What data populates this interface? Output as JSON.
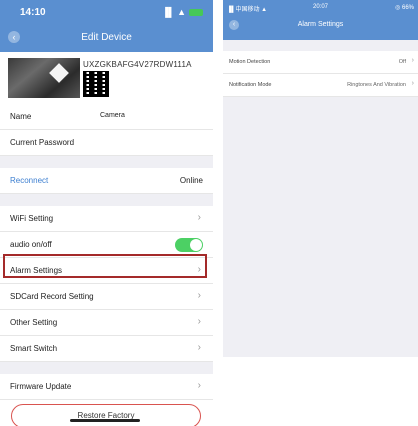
{
  "left_phone": {
    "status": {
      "time": "14:10",
      "signal": "▐▌ ▲"
    },
    "header": {
      "title": "Edit Device",
      "back": "‹"
    },
    "device": {
      "id": "UXZGKBAFG4V27RDW111A"
    },
    "rows": {
      "name": {
        "label": "Name",
        "value": "Camera"
      },
      "password": {
        "label": "Current Password"
      },
      "reconnect": {
        "label": "Reconnect",
        "value": "Online"
      },
      "wifi": {
        "label": "WiFi Setting"
      },
      "audio": {
        "label": "audio on/off",
        "toggle_on": true
      },
      "alarm": {
        "label": "Alarm Settings"
      },
      "sdcard": {
        "label": "SDCard Record Setting"
      },
      "other": {
        "label": "Other Setting"
      },
      "smart": {
        "label": "Smart Switch"
      },
      "firmware": {
        "label": "Firmware Update"
      }
    },
    "chevron": "›",
    "restore_label": "Restore Factory"
  },
  "right_phone": {
    "status": {
      "left": "▐▌中国移动 ▲",
      "time": "20:07",
      "right": "◎ 66%"
    },
    "header": {
      "title": "Alarm Settings",
      "back": "‹"
    },
    "rows": [
      {
        "label": "Motion Detection",
        "value": "Off"
      },
      {
        "label": "Notification Mode",
        "value": "Ringtones And Vibration"
      }
    ],
    "chevron": "›"
  },
  "colors": {
    "header_blue": "#5a8fd0",
    "toggle_green": "#4cd064",
    "highlight_red": "#a42a2a",
    "link_blue": "#3d7fd0"
  }
}
